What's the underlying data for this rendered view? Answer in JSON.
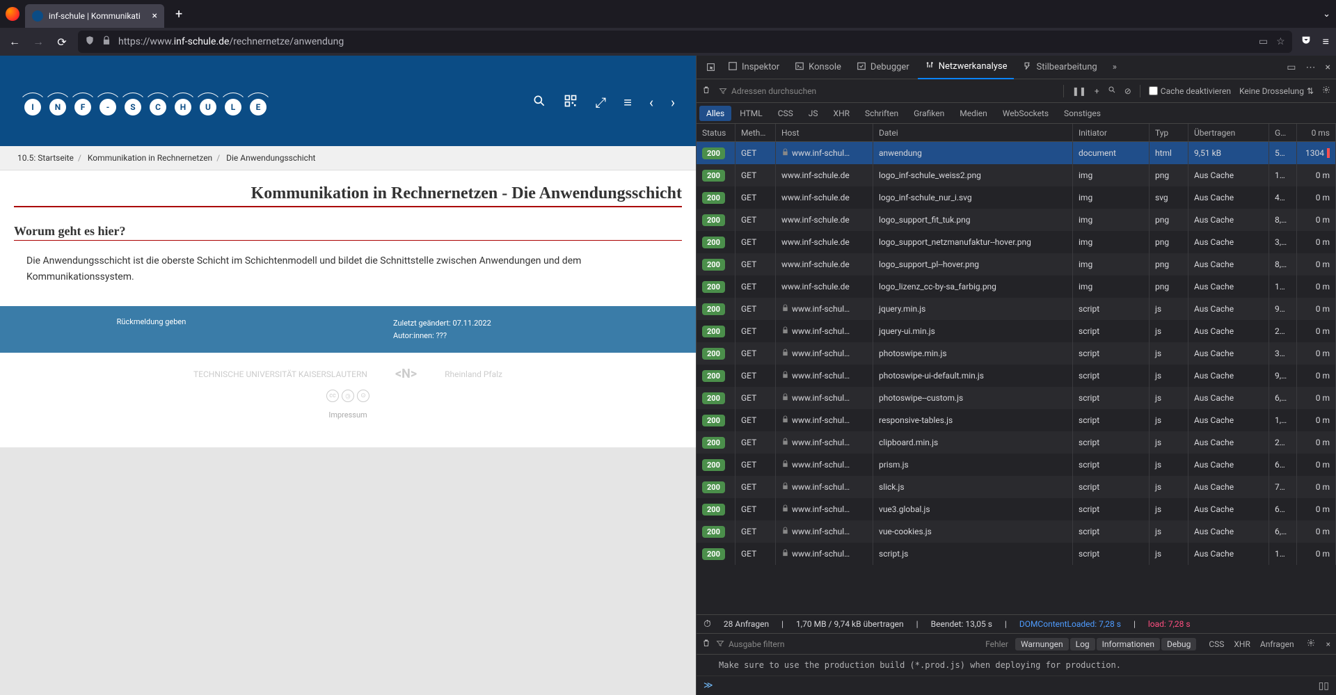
{
  "browser": {
    "tab_title": "inf-schule | Kommunikati",
    "url_prefix": "https://www.",
    "url_host": "inf-schule.de",
    "url_path": "/rechnernetze/anwendung"
  },
  "page": {
    "logo_letters": [
      "I",
      "N",
      "F",
      "-",
      "S",
      "C",
      "H",
      "U",
      "L",
      "E"
    ],
    "breadcrumb_prefix": "10.5:",
    "breadcrumb": [
      "Startseite",
      "Kommunikation in Rechnernetzen",
      "Die Anwendungsschicht"
    ],
    "breadcrumb_sep": "/",
    "title": "Kommunikation in Rechnernetzen - Die Anwendungsschicht",
    "section_heading": "Worum geht es hier?",
    "section_body": "Die Anwendungsschicht ist die oberste Schicht im Schichtenmodell und bildet die Schnittstelle zwischen Anwendungen und dem Kommunikationssystem.",
    "feedback": "Rückmeldung geben",
    "last_modified": "Zuletzt geändert: 07.11.2022",
    "authors": "Autor:innen: ???",
    "sponsors": [
      "TECHNISCHE UNIVERSITÄT KAISERSLAUTERN",
      "<N>",
      "Rheinland Pfalz"
    ],
    "impressum": "Impressum"
  },
  "devtools": {
    "tabs": [
      "Inspektor",
      "Konsole",
      "Debugger",
      "Netzwerkanalyse",
      "Stilbearbeitung"
    ],
    "active_tab": "Netzwerkanalyse",
    "filter_placeholder": "Adressen durchsuchen",
    "cache_disable": "Cache deaktivieren",
    "throttle": "Keine Drosselung",
    "filter_tabs": [
      "Alles",
      "HTML",
      "CSS",
      "JS",
      "XHR",
      "Schriften",
      "Grafiken",
      "Medien",
      "WebSockets",
      "Sonstiges"
    ],
    "columns": [
      "Status",
      "Meth…",
      "Host",
      "Datei",
      "Initiator",
      "Typ",
      "Übertragen",
      "G…",
      ""
    ],
    "time_header": "0 ms",
    "requests": [
      {
        "status": "200",
        "method": "GET",
        "secure": true,
        "host": "www.inf-schul…",
        "file": "anwendung",
        "init": "document",
        "type": "html",
        "trans": "9,51 kB",
        "size": "5…",
        "time": "1304",
        "selected": true
      },
      {
        "status": "200",
        "method": "GET",
        "secure": false,
        "host": "www.inf-schule.de",
        "file": "logo_inf-schule_weiss2.png",
        "init": "img",
        "type": "png",
        "trans": "Aus Cache",
        "size": "1…",
        "time": "0 m"
      },
      {
        "status": "200",
        "method": "GET",
        "secure": false,
        "host": "www.inf-schule.de",
        "file": "logo_inf-schule_nur_i.svg",
        "init": "img",
        "type": "svg",
        "trans": "Aus Cache",
        "size": "4…",
        "time": "0 m"
      },
      {
        "status": "200",
        "method": "GET",
        "secure": false,
        "host": "www.inf-schule.de",
        "file": "logo_support_fit_tuk.png",
        "init": "img",
        "type": "png",
        "trans": "Aus Cache",
        "size": "8,…",
        "time": "0 m"
      },
      {
        "status": "200",
        "method": "GET",
        "secure": false,
        "host": "www.inf-schule.de",
        "file": "logo_support_netzmanufaktur--hover.png",
        "init": "img",
        "type": "png",
        "trans": "Aus Cache",
        "size": "3,…",
        "time": "0 m"
      },
      {
        "status": "200",
        "method": "GET",
        "secure": false,
        "host": "www.inf-schule.de",
        "file": "logo_support_pl--hover.png",
        "init": "img",
        "type": "png",
        "trans": "Aus Cache",
        "size": "8,…",
        "time": "0 m"
      },
      {
        "status": "200",
        "method": "GET",
        "secure": false,
        "host": "www.inf-schule.de",
        "file": "logo_lizenz_cc-by-sa_farbig.png",
        "init": "img",
        "type": "png",
        "trans": "Aus Cache",
        "size": "1…",
        "time": "0 m"
      },
      {
        "status": "200",
        "method": "GET",
        "secure": true,
        "host": "www.inf-schul…",
        "file": "jquery.min.js",
        "init": "script",
        "type": "js",
        "trans": "Aus Cache",
        "size": "9…",
        "time": "0 m"
      },
      {
        "status": "200",
        "method": "GET",
        "secure": true,
        "host": "www.inf-schul…",
        "file": "jquery-ui.min.js",
        "init": "script",
        "type": "js",
        "trans": "Aus Cache",
        "size": "2…",
        "time": "0 m"
      },
      {
        "status": "200",
        "method": "GET",
        "secure": true,
        "host": "www.inf-schul…",
        "file": "photoswipe.min.js",
        "init": "script",
        "type": "js",
        "trans": "Aus Cache",
        "size": "3…",
        "time": "0 m"
      },
      {
        "status": "200",
        "method": "GET",
        "secure": true,
        "host": "www.inf-schul…",
        "file": "photoswipe-ui-default.min.js",
        "init": "script",
        "type": "js",
        "trans": "Aus Cache",
        "size": "9,…",
        "time": "0 m"
      },
      {
        "status": "200",
        "method": "GET",
        "secure": true,
        "host": "www.inf-schul…",
        "file": "photoswipe--custom.js",
        "init": "script",
        "type": "js",
        "trans": "Aus Cache",
        "size": "6,…",
        "time": "0 m"
      },
      {
        "status": "200",
        "method": "GET",
        "secure": true,
        "host": "www.inf-schul…",
        "file": "responsive-tables.js",
        "init": "script",
        "type": "js",
        "trans": "Aus Cache",
        "size": "1,…",
        "time": "0 m"
      },
      {
        "status": "200",
        "method": "GET",
        "secure": true,
        "host": "www.inf-schul…",
        "file": "clipboard.min.js",
        "init": "script",
        "type": "js",
        "trans": "Aus Cache",
        "size": "2…",
        "time": "0 m"
      },
      {
        "status": "200",
        "method": "GET",
        "secure": true,
        "host": "www.inf-schul…",
        "file": "prism.js",
        "init": "script",
        "type": "js",
        "trans": "Aus Cache",
        "size": "6…",
        "time": "0 m"
      },
      {
        "status": "200",
        "method": "GET",
        "secure": true,
        "host": "www.inf-schul…",
        "file": "slick.js",
        "init": "script",
        "type": "js",
        "trans": "Aus Cache",
        "size": "7…",
        "time": "0 m"
      },
      {
        "status": "200",
        "method": "GET",
        "secure": true,
        "host": "www.inf-schul…",
        "file": "vue3.global.js",
        "init": "script",
        "type": "js",
        "trans": "Aus Cache",
        "size": "6…",
        "time": "0 m"
      },
      {
        "status": "200",
        "method": "GET",
        "secure": true,
        "host": "www.inf-schul…",
        "file": "vue-cookies.js",
        "init": "script",
        "type": "js",
        "trans": "Aus Cache",
        "size": "6,…",
        "time": "0 m"
      },
      {
        "status": "200",
        "method": "GET",
        "secure": true,
        "host": "www.inf-schul…",
        "file": "script.js",
        "init": "script",
        "type": "js",
        "trans": "Aus Cache",
        "size": "1…",
        "time": "0 m"
      }
    ],
    "status_bar": {
      "request_count": "28 Anfragen",
      "transferred": "1,70 MB / 9,74 kB übertragen",
      "finished": "Beendet: 13,05 s",
      "dcl": "DOMContentLoaded: 7,28 s",
      "load": "load: 7,28 s"
    },
    "console": {
      "filter_placeholder": "Ausgabe filtern",
      "levels": {
        "fehler": "Fehler",
        "warnungen": "Warnungen",
        "log": "Log",
        "info": "Informationen",
        "debug": "Debug"
      },
      "right_items": [
        "CSS",
        "XHR",
        "Anfragen"
      ],
      "message": "Make sure to use the production build (*.prod.js) when deploying for production."
    }
  }
}
